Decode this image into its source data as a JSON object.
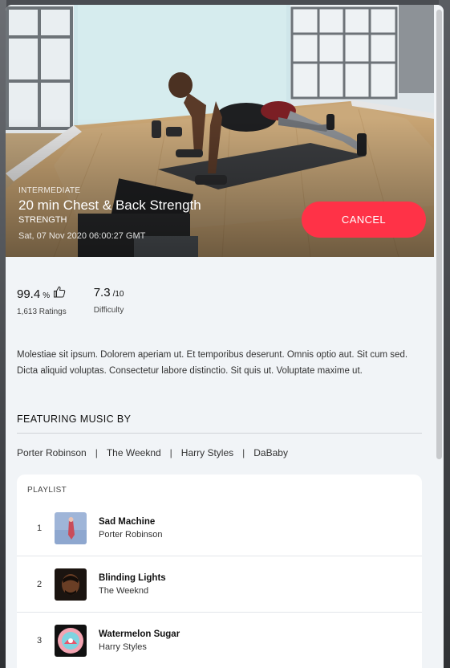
{
  "class": {
    "level": "INTERMEDIATE",
    "title": "20 min Chest & Back Strength",
    "category": "STRENGTH",
    "date": "Sat, 07 Nov 2020 06:00:27 GMT",
    "cancel_label": "CANCEL"
  },
  "stats": {
    "rating_value": "99.4",
    "rating_unit": "%",
    "rating_label": "1,613 Ratings",
    "difficulty_value": "7.3",
    "difficulty_unit": "/10",
    "difficulty_label": "Difficulty"
  },
  "description": "Molestiae sit ipsum. Dolorem aperiam ut. Et temporibus deserunt. Omnis optio aut. Sit cum sed. Dicta aliquid voluptas. Consectetur labore distinctio. Sit quis ut. Voluptate maxime ut.",
  "music": {
    "heading": "FEATURING MUSIC BY",
    "artists": [
      "Porter Robinson",
      "The Weeknd",
      "Harry Styles",
      "DaBaby"
    ],
    "separator": "|"
  },
  "playlist": {
    "heading": "PLAYLIST",
    "tracks": [
      {
        "num": "1",
        "title": "Sad Machine",
        "artist": "Porter Robinson"
      },
      {
        "num": "2",
        "title": "Blinding Lights",
        "artist": "The Weeknd"
      },
      {
        "num": "3",
        "title": "Watermelon Sugar",
        "artist": "Harry Styles"
      }
    ]
  },
  "colors": {
    "accent": "#ff3247",
    "panel": "#f1f4f7"
  },
  "icons": {
    "rating": "thumbs-up-icon"
  }
}
